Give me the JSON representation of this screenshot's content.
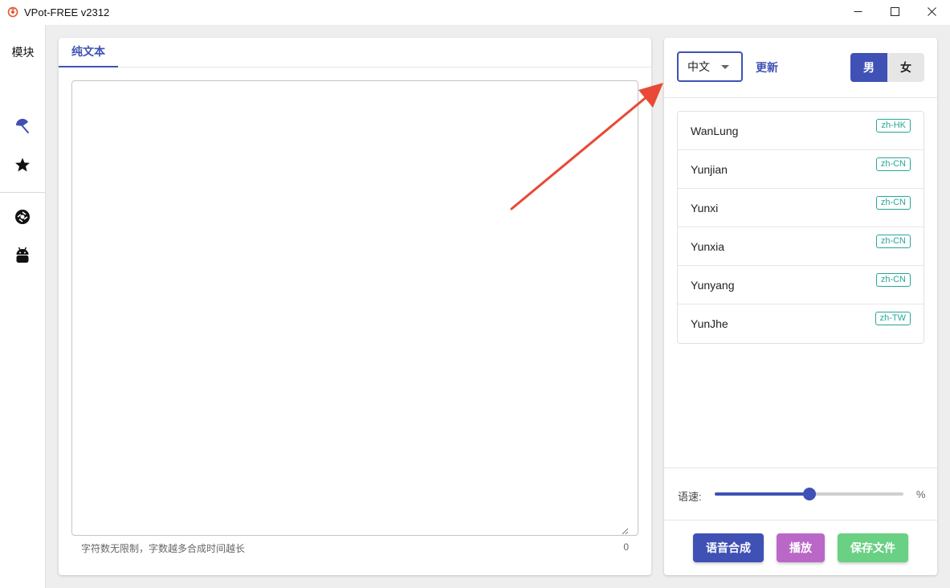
{
  "window": {
    "title": "VPot-FREE v2312",
    "controls": [
      "minimize-icon",
      "maximize-icon",
      "close-icon"
    ]
  },
  "sidebar": {
    "title": "模块",
    "items": [
      {
        "icon": "umbrella-icon"
      },
      {
        "icon": "star-icon"
      },
      {
        "icon": "aperture-icon"
      },
      {
        "icon": "android-icon"
      }
    ]
  },
  "editor": {
    "tab_label": "纯文本",
    "text_value": "",
    "hint": "字符数无限制，字数越多合成时间越长",
    "char_count": "0"
  },
  "voice_panel": {
    "language_select": "中文",
    "update_label": "更新",
    "gender": {
      "male": "男",
      "female": "女",
      "selected": "male"
    },
    "voices": [
      {
        "name": "WanLung",
        "locale": "zh-HK"
      },
      {
        "name": "Yunjian",
        "locale": "zh-CN"
      },
      {
        "name": "Yunxi",
        "locale": "zh-CN"
      },
      {
        "name": "Yunxia",
        "locale": "zh-CN"
      },
      {
        "name": "Yunyang",
        "locale": "zh-CN"
      },
      {
        "name": "YunJhe",
        "locale": "zh-TW"
      }
    ],
    "speed_label": "语速:",
    "speed_unit": "%",
    "speed_fraction": 0.5,
    "buttons": {
      "synthesize": "语音合成",
      "play": "播放",
      "save": "保存文件"
    }
  },
  "colors": {
    "primary": "#3f51b5",
    "tag": "#26a69a",
    "play": "#ba68c8",
    "save": "#69d084",
    "annotation_arrow": "#e84a35"
  }
}
